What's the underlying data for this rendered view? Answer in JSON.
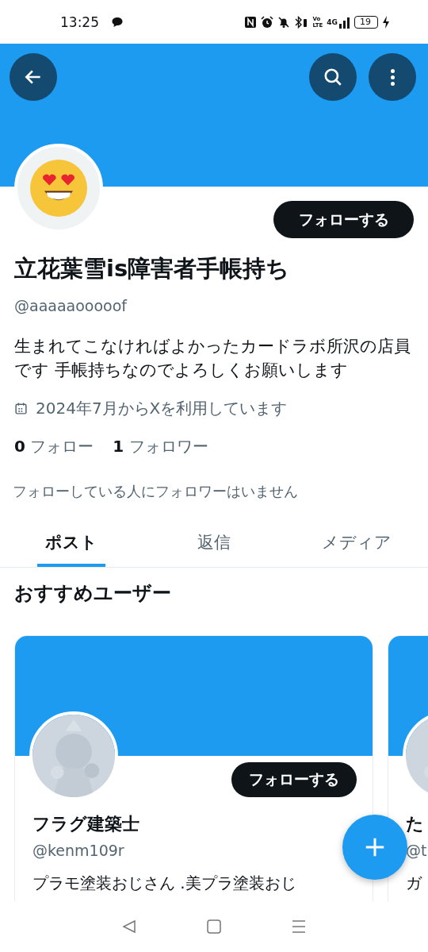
{
  "status_bar": {
    "time": "13:25",
    "volte_top": "Vo",
    "volte_bottom": "LTE",
    "network": "4G",
    "battery": "19"
  },
  "profile": {
    "follow_button": "フォローする",
    "name": "立花葉雪is障害者手帳持ち",
    "handle": "@aaaaaooooof",
    "bio": "生まれてこなければよかったカードラボ所沢の店員です 手帳持ちなのでよろしくお願いします",
    "joined": "2024年7月からXを利用しています",
    "following_count": "0",
    "following_label": "フォロー",
    "followers_count": "1",
    "followers_label": "フォロワー",
    "mutual_note": "フォローしている人にフォロワーはいません"
  },
  "tabs": [
    {
      "label": "ポスト",
      "selected": true
    },
    {
      "label": "返信",
      "selected": false
    },
    {
      "label": "メディア",
      "selected": false
    }
  ],
  "recommended": {
    "title": "おすすめユーザー",
    "users": [
      {
        "name": "フラグ建築士",
        "handle": "@kenm109r",
        "bio": "プラモ塗装おじさん .美プラ塗装おじ",
        "follow_button": "フォローする"
      },
      {
        "name": "た",
        "handle": "@t",
        "bio": "ガ"
      }
    ]
  }
}
